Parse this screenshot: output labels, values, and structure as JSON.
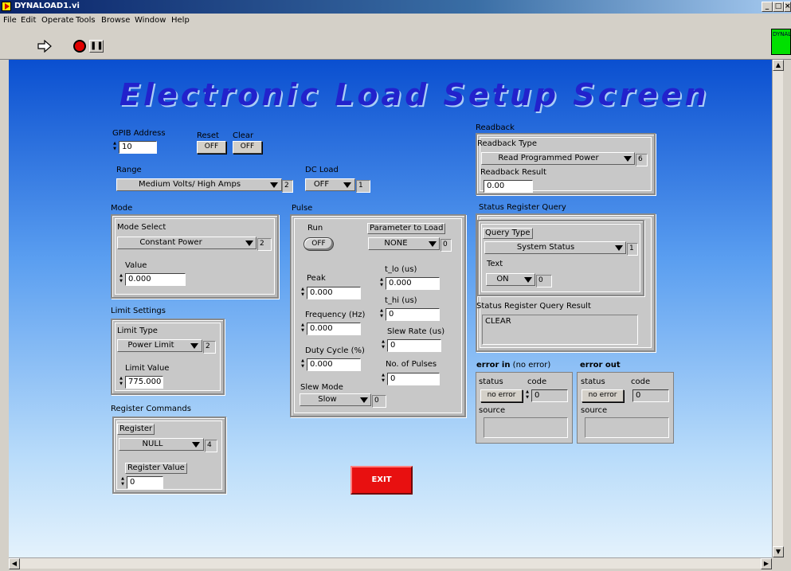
{
  "window": {
    "title": "DYNALOAD1.vi",
    "icon_name": "labview-vi-icon",
    "vi_icon_text": "DYNALOAD",
    "controls": [
      "_",
      "□",
      "×"
    ]
  },
  "menu": {
    "items": [
      "File",
      "Edit",
      "Operate",
      "Tools",
      "Browse",
      "Window",
      "Help"
    ]
  },
  "panel": {
    "title": "Electronic Load Setup Screen",
    "gpib": {
      "label": "GPIB Address",
      "value": "10"
    },
    "reset": {
      "label": "Reset",
      "value": "OFF"
    },
    "clear": {
      "label": "Clear",
      "value": "OFF"
    },
    "range": {
      "label": "Range",
      "value": "Medium Volts/ High Amps",
      "index": "2"
    },
    "dc_load": {
      "label": "DC Load",
      "value": "OFF",
      "index": "1"
    },
    "mode": {
      "label": "Mode",
      "select_label": "Mode Select",
      "select_value": "Constant Power",
      "select_index": "2",
      "value_label": "Value",
      "value": "0.000"
    },
    "limit": {
      "label": "Limit Settings",
      "type_label": "Limit Type",
      "type_value": "Power Limit",
      "type_index": "2",
      "value_label": "Limit Value",
      "value": "775.000"
    },
    "register": {
      "label": "Register Commands",
      "reg_label": "Register",
      "reg_value": "NULL",
      "reg_index": "4",
      "value_label": "Register Value",
      "value": "0"
    },
    "pulse": {
      "label": "Pulse",
      "run_label": "Run",
      "run_value": "OFF",
      "param_label": "Parameter to Load",
      "param_value": "NONE",
      "param_index": "0",
      "peak_label": "Peak",
      "peak_value": "0.000",
      "tlo_label": "t_lo (us)",
      "tlo_value": "0.000",
      "thi_label": "t_hi (us)",
      "thi_value": "0",
      "freq_label": "Frequency (Hz)",
      "freq_value": "0.000",
      "slew_rate_label": "Slew Rate (us)",
      "slew_rate_value": "0",
      "duty_label": "Duty Cycle (%)",
      "duty_value": "0.000",
      "pulses_label": "No. of Pulses",
      "pulses_value": "0",
      "slew_mode_label": "Slew Mode",
      "slew_mode_value": "Slow",
      "slew_mode_index": "0"
    },
    "readback": {
      "label": "Readback",
      "type_label": "Readback Type",
      "type_value": "Read Programmed Power",
      "type_index": "6",
      "result_label": "Readback Result",
      "result_value": "0.00"
    },
    "status_query": {
      "label": "Status Register Query",
      "query_label": "Query Type",
      "query_value": "System Status",
      "query_index": "1",
      "text_label": "Text",
      "text_value": "ON",
      "text_index": "0",
      "result_label": "Status Register Query Result",
      "result_value": "CLEAR"
    },
    "error_in": {
      "label_bold": "error in",
      "label_rest": " (no error)",
      "status_label": "status",
      "code_label": "code",
      "status_value": "no error",
      "code_value": "0",
      "source_label": "source"
    },
    "error_out": {
      "label": "error out",
      "status_label": "status",
      "code_label": "code",
      "status_value": "no error",
      "code_value": "0",
      "source_label": "source"
    },
    "exit_label": "EXIT"
  }
}
